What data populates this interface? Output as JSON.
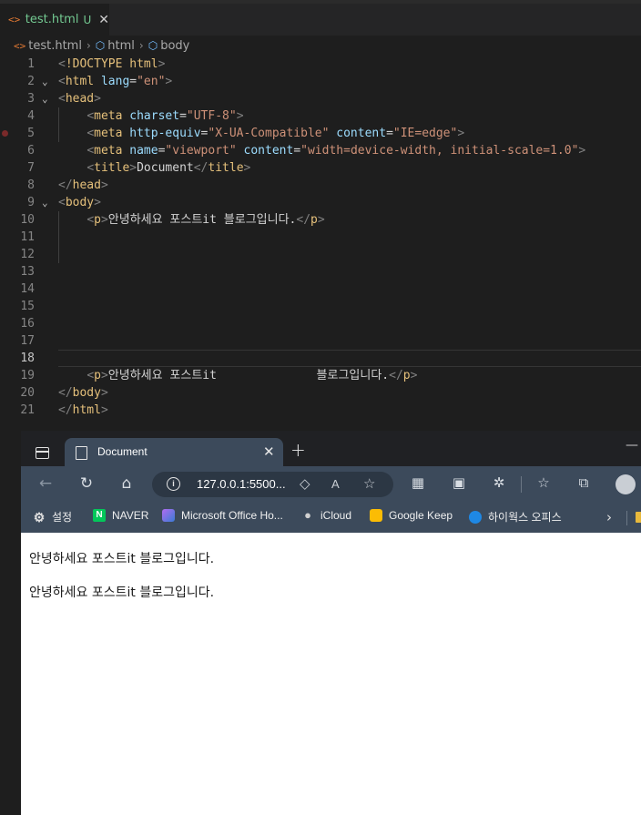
{
  "editor": {
    "tab": {
      "icon": "html-file-icon",
      "filename": "test.html",
      "status": "U"
    },
    "breadcrumb": [
      "test.html",
      "html",
      "body"
    ],
    "lines": [
      {
        "n": "1",
        "fold": "",
        "segs": [
          [
            "b",
            "<"
          ],
          [
            "tag",
            "!DOCTYPE html"
          ],
          [
            "b",
            ">"
          ]
        ]
      },
      {
        "n": "2",
        "fold": "⌄",
        "segs": [
          [
            "b",
            "<"
          ],
          [
            "tag",
            "html"
          ],
          [
            "attr",
            " lang"
          ],
          [
            "txt",
            "="
          ],
          [
            "val",
            "\"en\""
          ],
          [
            "b",
            ">"
          ]
        ]
      },
      {
        "n": "3",
        "fold": "⌄",
        "segs": [
          [
            "b",
            "<"
          ],
          [
            "tag",
            "head"
          ],
          [
            "b",
            ">"
          ]
        ]
      },
      {
        "n": "4",
        "fold": "",
        "segs": [
          [
            "txt",
            "    "
          ],
          [
            "b",
            "<"
          ],
          [
            "tag",
            "meta"
          ],
          [
            "attr",
            " charset"
          ],
          [
            "txt",
            "="
          ],
          [
            "val",
            "\"UTF-8\""
          ],
          [
            "b",
            ">"
          ]
        ]
      },
      {
        "n": "5",
        "fold": "",
        "segs": [
          [
            "txt",
            "    "
          ],
          [
            "b",
            "<"
          ],
          [
            "tag",
            "meta"
          ],
          [
            "attr",
            " http-equiv"
          ],
          [
            "txt",
            "="
          ],
          [
            "val",
            "\"X-UA-Compatible\""
          ],
          [
            "attr",
            " content"
          ],
          [
            "txt",
            "="
          ],
          [
            "val",
            "\"IE=edge\""
          ],
          [
            "b",
            ">"
          ]
        ]
      },
      {
        "n": "6",
        "fold": "",
        "segs": [
          [
            "txt",
            "    "
          ],
          [
            "b",
            "<"
          ],
          [
            "tag",
            "meta"
          ],
          [
            "attr",
            " name"
          ],
          [
            "txt",
            "="
          ],
          [
            "val",
            "\"viewport\""
          ],
          [
            "attr",
            " content"
          ],
          [
            "txt",
            "="
          ],
          [
            "val",
            "\"width=device-width, initial-scale=1.0\""
          ],
          [
            "b",
            ">"
          ]
        ]
      },
      {
        "n": "7",
        "fold": "",
        "segs": [
          [
            "txt",
            "    "
          ],
          [
            "b",
            "<"
          ],
          [
            "tag",
            "title"
          ],
          [
            "b",
            ">"
          ],
          [
            "txt",
            "Document"
          ],
          [
            "b",
            "</"
          ],
          [
            "tag",
            "title"
          ],
          [
            "b",
            ">"
          ]
        ]
      },
      {
        "n": "8",
        "fold": "",
        "segs": [
          [
            "b",
            "</"
          ],
          [
            "tag",
            "head"
          ],
          [
            "b",
            ">"
          ]
        ]
      },
      {
        "n": "9",
        "fold": "⌄",
        "segs": [
          [
            "b",
            "<"
          ],
          [
            "tag",
            "body"
          ],
          [
            "b",
            ">"
          ]
        ]
      },
      {
        "n": "10",
        "fold": "",
        "segs": [
          [
            "txt",
            "    "
          ],
          [
            "b",
            "<"
          ],
          [
            "tag",
            "p"
          ],
          [
            "b",
            ">"
          ],
          [
            "txt",
            "안녕하세요 포스트it 블로그입니다."
          ],
          [
            "b",
            "</"
          ],
          [
            "tag",
            "p"
          ],
          [
            "b",
            ">"
          ]
        ]
      },
      {
        "n": "11",
        "fold": "",
        "segs": []
      },
      {
        "n": "12",
        "fold": "",
        "segs": []
      },
      {
        "n": "13",
        "fold": "",
        "segs": []
      },
      {
        "n": "14",
        "fold": "",
        "segs": []
      },
      {
        "n": "15",
        "fold": "",
        "segs": []
      },
      {
        "n": "16",
        "fold": "",
        "segs": []
      },
      {
        "n": "17",
        "fold": "",
        "segs": []
      },
      {
        "n": "18",
        "fold": "",
        "segs": []
      },
      {
        "n": "19",
        "fold": "",
        "segs": [
          [
            "txt",
            "    "
          ],
          [
            "b",
            "<"
          ],
          [
            "tag",
            "p"
          ],
          [
            "b",
            ">"
          ],
          [
            "txt",
            "안녕하세요 포스트it              블로그입니다."
          ],
          [
            "b",
            "</"
          ],
          [
            "tag",
            "p"
          ],
          [
            "b",
            ">"
          ]
        ]
      },
      {
        "n": "20",
        "fold": "",
        "segs": [
          [
            "b",
            "</"
          ],
          [
            "tag",
            "body"
          ],
          [
            "b",
            ">"
          ]
        ]
      },
      {
        "n": "21",
        "fold": "",
        "segs": [
          [
            "b",
            "</"
          ],
          [
            "tag",
            "html"
          ],
          [
            "b",
            ">"
          ]
        ]
      }
    ]
  },
  "browser": {
    "tab_title": "Document",
    "url": "127.0.0.1:5500...",
    "bookmarks": [
      {
        "label": "설정",
        "icon": "gear-icon"
      },
      {
        "label": "NAVER",
        "icon": "naver-icon",
        "glyph": "N"
      },
      {
        "label": "Microsoft Office Ho...",
        "icon": "office-icon"
      },
      {
        "label": "iCloud",
        "icon": "apple-icon"
      },
      {
        "label": "Google Keep",
        "icon": "keep-icon"
      },
      {
        "label": "하이웍스 오피스",
        "icon": "hiworks-icon"
      }
    ],
    "content": [
      "안녕하세요 포스트it 블로그입니다.",
      "안녕하세요 포스트it 블로그입니다."
    ]
  },
  "colors": {
    "tag": "#e5c07b",
    "attr": "#9cdcfe",
    "value": "#ce9178",
    "modified": "#73c991",
    "naver": "#03c75a"
  }
}
